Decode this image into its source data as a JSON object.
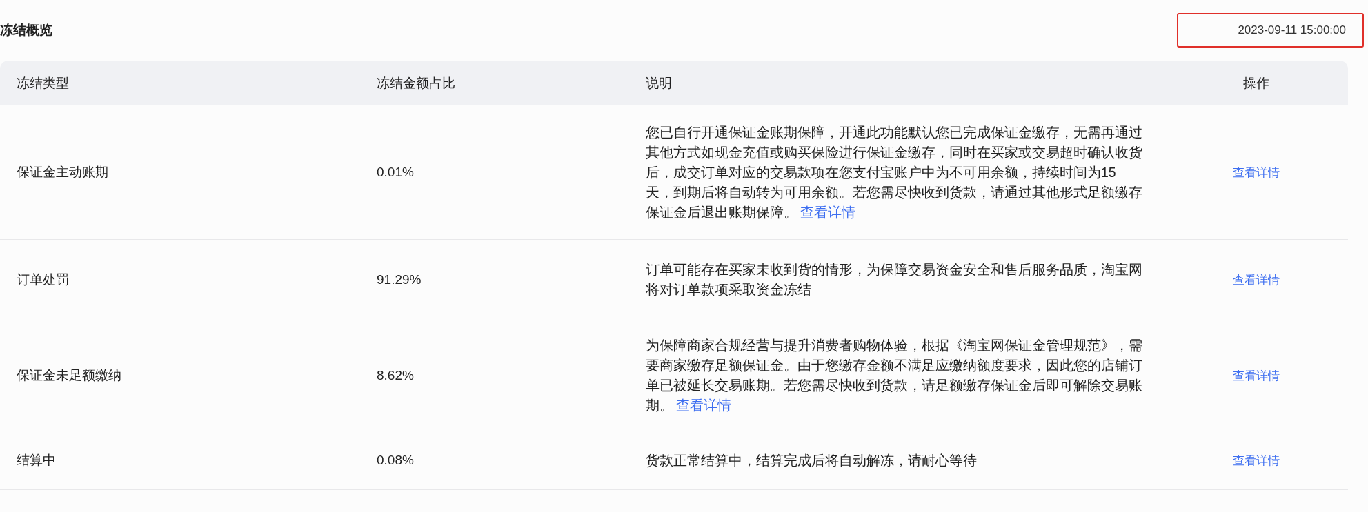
{
  "title": "冻结概览",
  "timestamp": "2023-09-11 15:00:00",
  "table": {
    "columns": [
      "冻结类型",
      "冻结金额占比",
      "说明",
      "操作"
    ],
    "rows": [
      {
        "type": "保证金主动账期",
        "share": "0.01%",
        "description": "您已自行开通保证金账期保障，开通此功能默认您已完成保证金缴存，无需再通过其他方式如现金充值或购买保险进行保证金缴存，同时在买家或交易超时确认收货后，成交订单对应的交易款项在您支付宝账户中为不可用余额，持续时间为15天，到期后将自动转为可用余额。若您需尽快收到货款，请通过其他形式足额缴存保证金后退出账期保障。",
        "link": "查看详情",
        "action": "查看详情"
      },
      {
        "type": "订单处罚",
        "share": "91.29%",
        "description": "订单可能存在买家未收到货的情形，为保障交易资金安全和售后服务品质，淘宝网将对订单款项采取资金冻结",
        "action": "查看详情"
      },
      {
        "type": "保证金未足额缴纳",
        "share": "8.62%",
        "description": "为保障商家合规经营与提升消费者购物体验，根据《淘宝网保证金管理规范》，需要商家缴存足额保证金。由于您缴存金额不满足应缴纳额度要求，因此您的店铺订单已被延长交易账期。若您需尽快收到货款，请足额缴存保证金后即可解除交易账期。",
        "link": "查看详情",
        "action": "查看详情"
      },
      {
        "type": "结算中",
        "share": "0.08%",
        "description": "货款正常结算中，结算完成后将自动解冻，请耐心等待",
        "action": "查看详情"
      }
    ]
  }
}
